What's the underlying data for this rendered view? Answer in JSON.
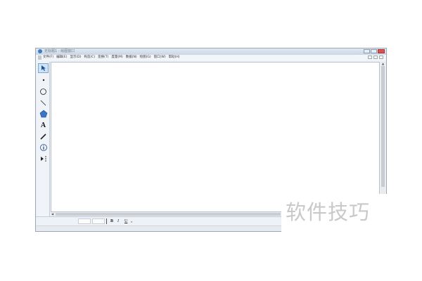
{
  "window": {
    "title": "无标题1 - 绘图窗口"
  },
  "menu": {
    "items": [
      "文件(F)",
      "编辑(E)",
      "显示(D)",
      "构造(C)",
      "变换(T)",
      "度量(M)",
      "数据(N)",
      "绘图(G)",
      "窗口(W)",
      "帮助(H)"
    ]
  },
  "toolbox": {
    "tools": [
      {
        "name": "select-arrow-tool",
        "icon": "arrow-icon",
        "active": true
      },
      {
        "name": "point-tool",
        "icon": "point-icon"
      },
      {
        "name": "compass-tool",
        "icon": "circle-icon"
      },
      {
        "name": "straightedge-tool",
        "icon": "line-icon"
      },
      {
        "name": "polygon-tool",
        "icon": "polygon-icon"
      },
      {
        "name": "text-tool",
        "icon": "text-a-icon",
        "glyph": "A"
      },
      {
        "name": "marker-tool",
        "icon": "pen-icon"
      },
      {
        "name": "information-tool",
        "icon": "info-icon"
      },
      {
        "name": "custom-tool",
        "icon": "custom-tool-icon"
      }
    ]
  },
  "textbar": {
    "bold": "B",
    "italic": "I",
    "underline": "U",
    "symbol": "ᵩ"
  },
  "watermark": {
    "text": "软件技巧"
  },
  "colors": {
    "accent": "#3c7fc1",
    "active_tool_bg": "#cfe3f7"
  }
}
